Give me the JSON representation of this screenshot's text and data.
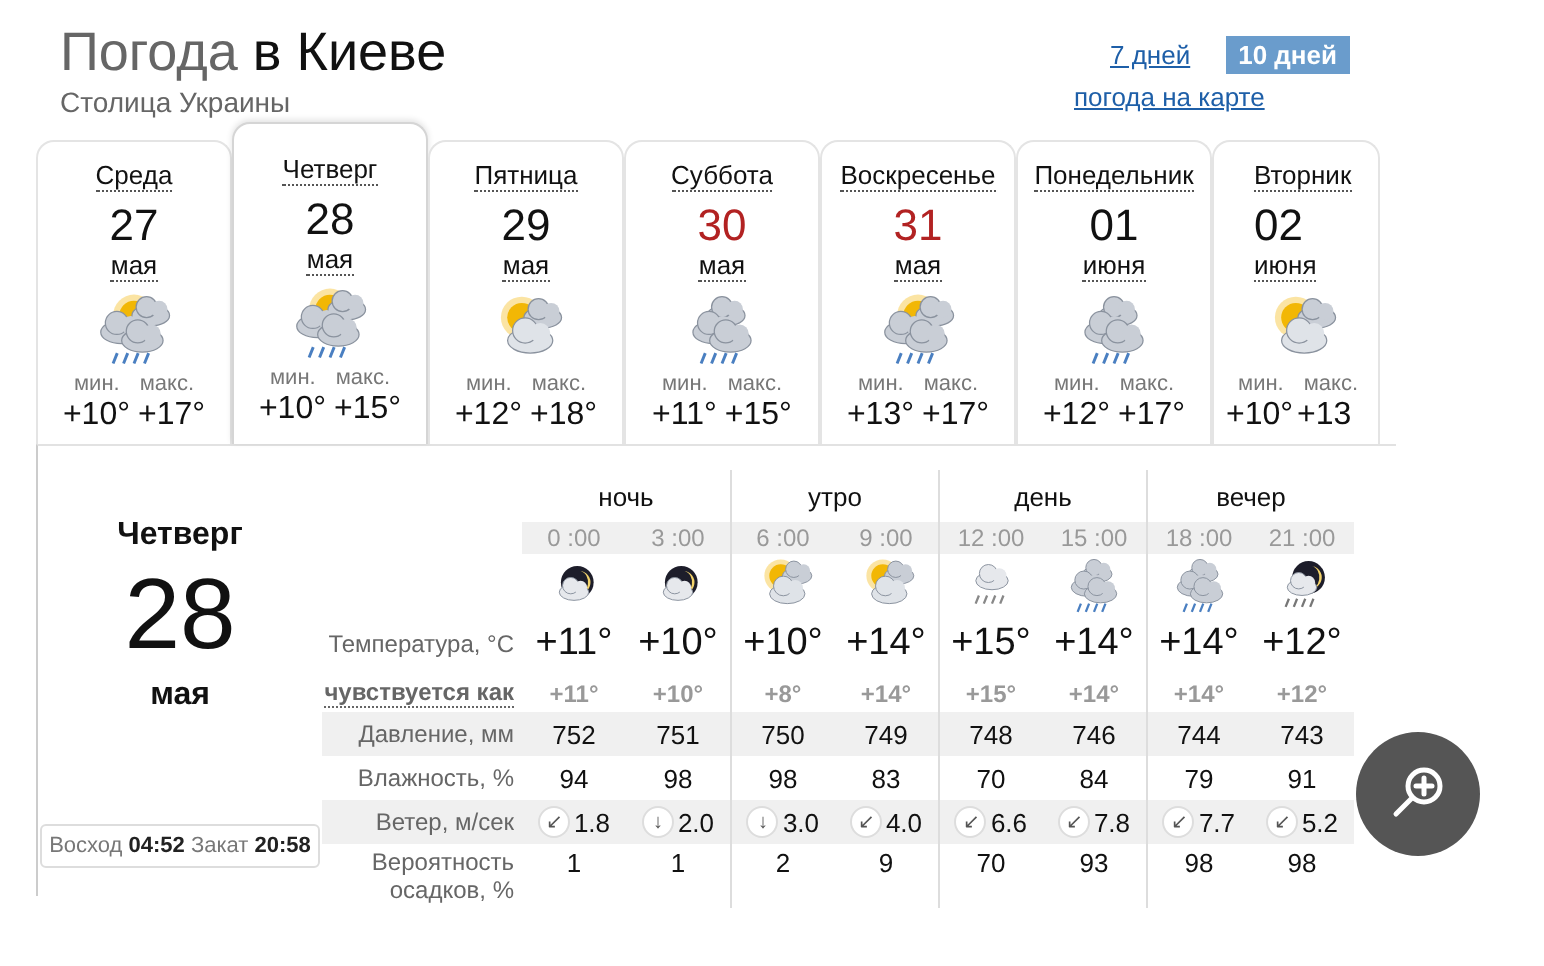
{
  "header": {
    "title_prefix": "Погода",
    "title_city": "в Киеве",
    "subtitle": "Столица Украины"
  },
  "range_tabs": [
    {
      "label": "7 дней",
      "selected": false
    },
    {
      "label": "10 дней",
      "selected": true
    }
  ],
  "map_link": "погода на карте",
  "days": [
    {
      "weekday": "Среда",
      "date": "27",
      "month": "мая",
      "kind": "sun_cloud_rain",
      "min_label": "мин.",
      "max_label": "макс.",
      "min": "+10°",
      "max": "+17°",
      "weekend": false,
      "selected": false
    },
    {
      "weekday": "Четверг",
      "date": "28",
      "month": "мая",
      "kind": "sun_cloud_rain",
      "min_label": "мин.",
      "max_label": "макс.",
      "min": "+10°",
      "max": "+15°",
      "weekend": false,
      "selected": true
    },
    {
      "weekday": "Пятница",
      "date": "29",
      "month": "мая",
      "kind": "sun_cloud",
      "min_label": "мин.",
      "max_label": "макс.",
      "min": "+12°",
      "max": "+18°",
      "weekend": false,
      "selected": false
    },
    {
      "weekday": "Суббота",
      "date": "30",
      "month": "мая",
      "kind": "cloud_rain",
      "min_label": "мин.",
      "max_label": "макс.",
      "min": "+11°",
      "max": "+15°",
      "weekend": true,
      "selected": false
    },
    {
      "weekday": "Воскресенье",
      "date": "31",
      "month": "мая",
      "kind": "sun_cloud_rain",
      "min_label": "мин.",
      "max_label": "макс.",
      "min": "+13°",
      "max": "+17°",
      "weekend": true,
      "selected": false
    },
    {
      "weekday": "Понедельник",
      "date": "01",
      "month": "июня",
      "kind": "cloud_rain",
      "min_label": "мин.",
      "max_label": "макс.",
      "min": "+12°",
      "max": "+17°",
      "weekend": false,
      "selected": false
    },
    {
      "weekday": "Вторник",
      "date": "02",
      "month": "июня",
      "kind": "sun_cloud",
      "min_label": "мин.",
      "max_label": "макс.",
      "min": "+10°",
      "max": "+13",
      "weekend": false,
      "selected": false
    }
  ],
  "detail": {
    "weekday": "Четверг",
    "date": "28",
    "month": "мая",
    "sun": "Восход **04:52** Закат **20:58**",
    "periods": [
      "ночь",
      "утро",
      "день",
      "вечер"
    ],
    "labels": {
      "temperature": "Температура, °С",
      "feels": "чувствуется как",
      "pressure": "Давление, мм",
      "humidity": "Влажность, %",
      "wind": "Ветер, м/сек",
      "precip": "Вероятность осадков, %"
    },
    "hours": [
      {
        "time": "0 :00",
        "kind": "moon_cloud",
        "temp": "+11°",
        "feels": "+11°",
        "pressure": "752",
        "humidity": "94",
        "wind_arrow": "↙",
        "wind": "1.8",
        "precip": "1"
      },
      {
        "time": "3 :00",
        "kind": "moon_cloud",
        "temp": "+10°",
        "feels": "+10°",
        "pressure": "751",
        "humidity": "98",
        "wind_arrow": "↓",
        "wind": "2.0",
        "precip": "1"
      },
      {
        "time": "6 :00",
        "kind": "sun_cloud",
        "temp": "+10°",
        "feels": "+8°",
        "pressure": "750",
        "humidity": "98",
        "wind_arrow": "↓",
        "wind": "3.0",
        "precip": "2"
      },
      {
        "time": "9 :00",
        "kind": "sun_cloud",
        "temp": "+14°",
        "feels": "+14°",
        "pressure": "749",
        "humidity": "83",
        "wind_arrow": "↙",
        "wind": "4.0",
        "precip": "9"
      },
      {
        "time": "12 :00",
        "kind": "cloud_drizzle",
        "temp": "+15°",
        "feels": "+15°",
        "pressure": "748",
        "humidity": "70",
        "wind_arrow": "↙",
        "wind": "6.6",
        "precip": "70"
      },
      {
        "time": "15 :00",
        "kind": "cloud_rain",
        "temp": "+14°",
        "feels": "+14°",
        "pressure": "746",
        "humidity": "84",
        "wind_arrow": "↙",
        "wind": "7.8",
        "precip": "93"
      },
      {
        "time": "18 :00",
        "kind": "cloud_rain",
        "temp": "+14°",
        "feels": "+14°",
        "pressure": "744",
        "humidity": "79",
        "wind_arrow": "↙",
        "wind": "7.7",
        "precip": "98"
      },
      {
        "time": "21 :00",
        "kind": "moon_cloud_rain",
        "temp": "+12°",
        "feels": "+12°",
        "pressure": "743",
        "humidity": "91",
        "wind_arrow": "↙",
        "wind": "5.2",
        "precip": "98"
      }
    ]
  }
}
